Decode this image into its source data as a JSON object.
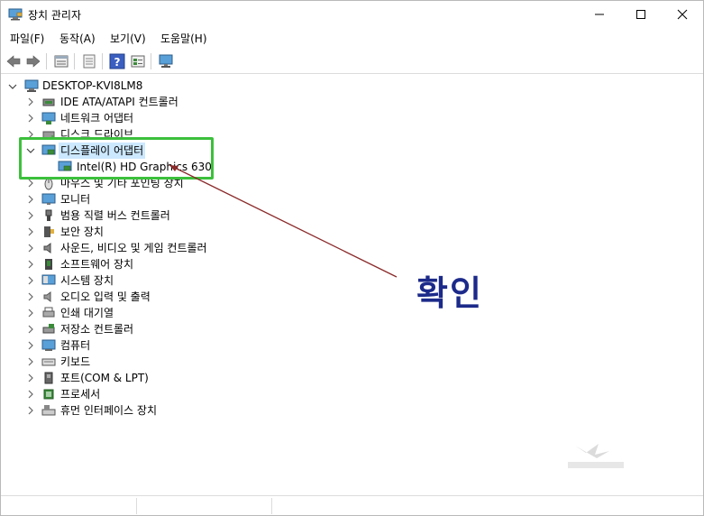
{
  "window": {
    "title": "장치 관리자",
    "controls": [
      "minimize",
      "maximize",
      "close"
    ]
  },
  "menu": [
    {
      "label": "파일(F)"
    },
    {
      "label": "동작(A)"
    },
    {
      "label": "보기(V)"
    },
    {
      "label": "도움말(H)"
    }
  ],
  "toolbar": {
    "buttons": [
      "back-arrow-icon",
      "forward-arrow-icon",
      "properties-icon",
      "view-icon",
      "help-icon",
      "list-view-icon",
      "monitor-scan-icon"
    ]
  },
  "tree": {
    "root": "DESKTOP-KVI8LM8",
    "items": [
      {
        "label": "IDE ATA/ATAPI 컨트롤러",
        "icon": "ide-controller-icon",
        "expanded": false
      },
      {
        "label": "네트워크 어댑터",
        "icon": "network-adapter-icon",
        "expanded": false
      },
      {
        "label": "디스크 드라이브",
        "icon": "disk-drive-icon",
        "expanded": false
      },
      {
        "label": "디스플레이 어댑터",
        "icon": "display-adapter-icon",
        "expanded": true,
        "selected": true,
        "children": [
          {
            "label": "Intel(R) HD Graphics 630",
            "icon": "display-adapter-icon"
          }
        ]
      },
      {
        "label": "마우스 및 기타 포인팅 장치",
        "icon": "mouse-icon",
        "expanded": false
      },
      {
        "label": "모니터",
        "icon": "monitor-icon",
        "expanded": false
      },
      {
        "label": "범용 직렬 버스 컨트롤러",
        "icon": "usb-icon",
        "expanded": false
      },
      {
        "label": "보안 장치",
        "icon": "security-device-icon",
        "expanded": false
      },
      {
        "label": "사운드, 비디오 및 게임 컨트롤러",
        "icon": "speaker-icon",
        "expanded": false
      },
      {
        "label": "소프트웨어 장치",
        "icon": "software-device-icon",
        "expanded": false
      },
      {
        "label": "시스템 장치",
        "icon": "system-device-icon",
        "expanded": false
      },
      {
        "label": "오디오 입력 및 출력",
        "icon": "audio-io-icon",
        "expanded": false
      },
      {
        "label": "인쇄 대기열",
        "icon": "printer-icon",
        "expanded": false
      },
      {
        "label": "저장소 컨트롤러",
        "icon": "storage-controller-icon",
        "expanded": false
      },
      {
        "label": "컴퓨터",
        "icon": "computer-icon",
        "expanded": false
      },
      {
        "label": "키보드",
        "icon": "keyboard-icon",
        "expanded": false
      },
      {
        "label": "포트(COM & LPT)",
        "icon": "port-icon",
        "expanded": false
      },
      {
        "label": "프로세서",
        "icon": "processor-icon",
        "expanded": false
      },
      {
        "label": "휴먼 인터페이스 장치",
        "icon": "hid-icon",
        "expanded": false
      }
    ]
  },
  "annotation": {
    "text": "확인",
    "color": "#1c2a8a",
    "box_color": "#3cc03c",
    "arrow_color": "#8b2a2a"
  }
}
